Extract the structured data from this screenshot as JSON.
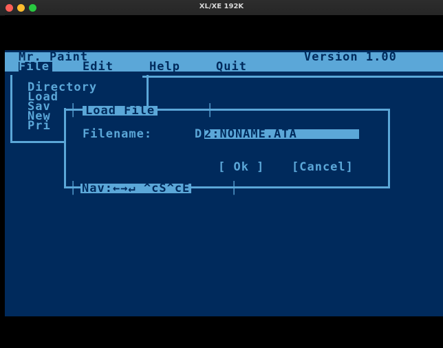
{
  "window": {
    "title": "XL/XE 192K"
  },
  "header": {
    "app_name": "Mr. Paint",
    "version": "Version 1.00"
  },
  "menubar": {
    "items": [
      "File",
      "Edit",
      "Help",
      "Quit"
    ]
  },
  "file_menu": {
    "items": [
      "Directory",
      "Load",
      "Sav",
      "New",
      "Pri"
    ]
  },
  "dialog": {
    "title": "Load File",
    "filename_label": "Filename:",
    "filename_prefix": "D",
    "filename_value": "2:NONAME.ATA",
    "ok_label": "[ Ok ]",
    "cancel_label": "[Cancel]",
    "nav_hint": "Nav:←→↵ ^cS^cE"
  },
  "colors": {
    "background": "#002a5c",
    "foreground": "#5ba7d8"
  }
}
